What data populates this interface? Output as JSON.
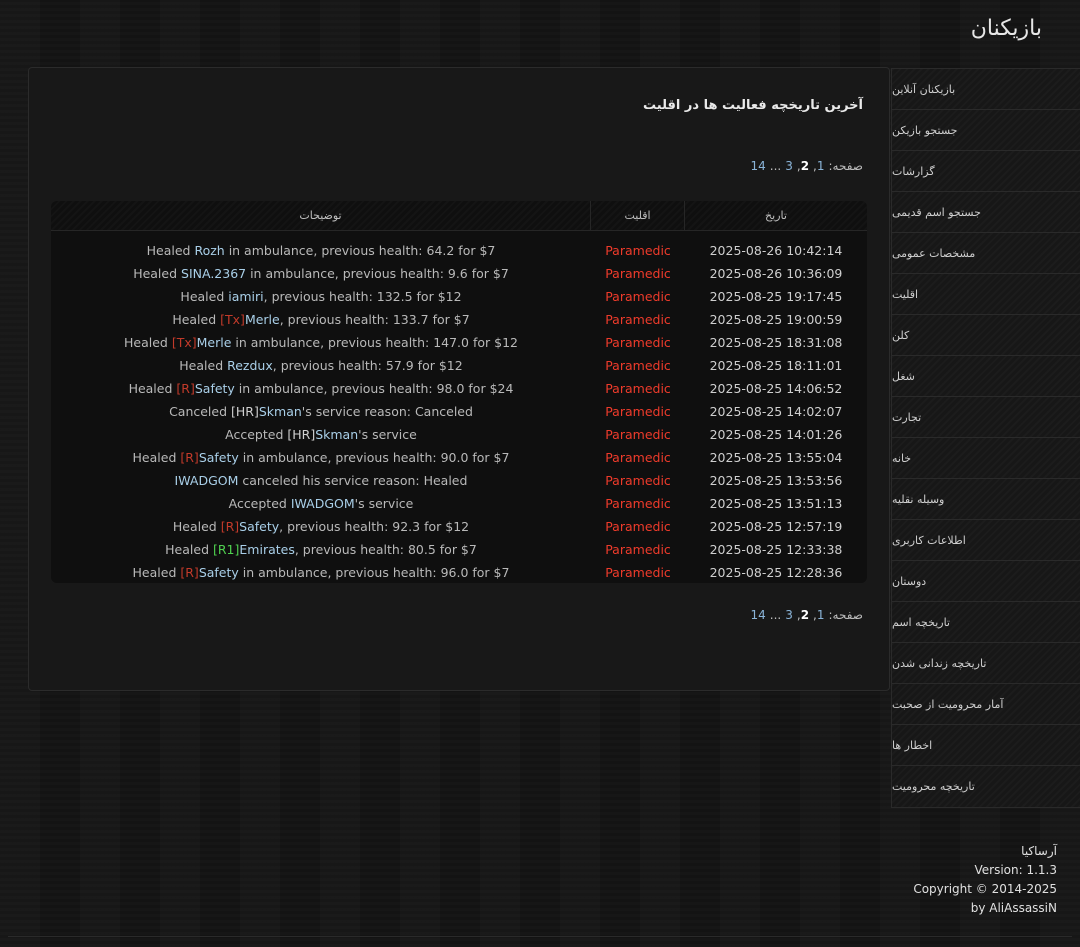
{
  "page_title": "بازیکنان",
  "main": {
    "heading": "آخرین تاریخچه فعالیت ها در اقلیت",
    "pager": {
      "label": "صفحه:",
      "p1": "1",
      "p2": "2",
      "p3": "3",
      "dots": "...",
      "last": "14"
    },
    "table": {
      "headers": {
        "date": "تاریخ",
        "faction": "اقلیت",
        "desc": "توضیحات"
      },
      "rows": [
        {
          "date": "2025-08-26 10:42:14",
          "faction": "Paramedic",
          "parts": [
            {
              "t": "Healed "
            },
            {
              "t": "Rozh",
              "c": "pn"
            },
            {
              "t": " in ambulance, previous health: 64.2 for $7"
            }
          ]
        },
        {
          "date": "2025-08-26 10:36:09",
          "faction": "Paramedic",
          "parts": [
            {
              "t": "Healed "
            },
            {
              "t": "SINA.2367",
              "c": "pn"
            },
            {
              "t": " in ambulance, previous health: 9.6 for $7"
            }
          ]
        },
        {
          "date": "2025-08-25 19:17:45",
          "faction": "Paramedic",
          "parts": [
            {
              "t": "Healed "
            },
            {
              "t": "iamiri",
              "c": "pn"
            },
            {
              "t": ", previous health: 132.5 for $12"
            }
          ]
        },
        {
          "date": "2025-08-25 19:00:59",
          "faction": "Paramedic",
          "parts": [
            {
              "t": "Healed "
            },
            {
              "t": "[Tx]",
              "c": "tg-red"
            },
            {
              "t": "Merle",
              "c": "pn"
            },
            {
              "t": ", previous health: 133.7 for $7"
            }
          ]
        },
        {
          "date": "2025-08-25 18:31:08",
          "faction": "Paramedic",
          "parts": [
            {
              "t": "Healed "
            },
            {
              "t": "[Tx]",
              "c": "tg-red"
            },
            {
              "t": "Merle",
              "c": "pn"
            },
            {
              "t": " in ambulance, previous health: 147.0 for $12"
            }
          ]
        },
        {
          "date": "2025-08-25 18:11:01",
          "faction": "Paramedic",
          "parts": [
            {
              "t": "Healed "
            },
            {
              "t": "Rezdux",
              "c": "pn"
            },
            {
              "t": ", previous health: 57.9 for $12"
            }
          ]
        },
        {
          "date": "2025-08-25 14:06:52",
          "faction": "Paramedic",
          "parts": [
            {
              "t": "Healed "
            },
            {
              "t": "[R]",
              "c": "tg-red"
            },
            {
              "t": "Safety",
              "c": "pn"
            },
            {
              "t": " in ambulance, previous health: 98.0 for $24"
            }
          ]
        },
        {
          "date": "2025-08-25 14:02:07",
          "faction": "Paramedic",
          "parts": [
            {
              "t": "Canceled "
            },
            {
              "t": "[HR]",
              "c": "tg-grey"
            },
            {
              "t": "Skman",
              "c": "pn"
            },
            {
              "t": "'s service reason: Canceled"
            }
          ]
        },
        {
          "date": "2025-08-25 14:01:26",
          "faction": "Paramedic",
          "parts": [
            {
              "t": "Accepted "
            },
            {
              "t": "[HR]",
              "c": "tg-grey"
            },
            {
              "t": "Skman",
              "c": "pn"
            },
            {
              "t": "'s service"
            }
          ]
        },
        {
          "date": "2025-08-25 13:55:04",
          "faction": "Paramedic",
          "parts": [
            {
              "t": "Healed "
            },
            {
              "t": "[R]",
              "c": "tg-red"
            },
            {
              "t": "Safety",
              "c": "pn"
            },
            {
              "t": " in ambulance, previous health: 90.0 for $7"
            }
          ]
        },
        {
          "date": "2025-08-25 13:53:56",
          "faction": "Paramedic",
          "parts": [
            {
              "t": "IWADGOM",
              "c": "pn"
            },
            {
              "t": " canceled his service reason: Healed"
            }
          ]
        },
        {
          "date": "2025-08-25 13:51:13",
          "faction": "Paramedic",
          "parts": [
            {
              "t": "Accepted "
            },
            {
              "t": "IWADGOM",
              "c": "pn"
            },
            {
              "t": "'s service"
            }
          ]
        },
        {
          "date": "2025-08-25 12:57:19",
          "faction": "Paramedic",
          "parts": [
            {
              "t": "Healed "
            },
            {
              "t": "[R]",
              "c": "tg-red"
            },
            {
              "t": "Safety",
              "c": "pn"
            },
            {
              "t": ", previous health: 92.3 for $12"
            }
          ]
        },
        {
          "date": "2025-08-25 12:33:38",
          "faction": "Paramedic",
          "parts": [
            {
              "t": "Healed "
            },
            {
              "t": "[R1]",
              "c": "tg-green"
            },
            {
              "t": "Emirates",
              "c": "pn"
            },
            {
              "t": ", previous health: 80.5 for $7"
            }
          ]
        },
        {
          "date": "2025-08-25 12:28:36",
          "faction": "Paramedic",
          "parts": [
            {
              "t": "Healed "
            },
            {
              "t": "[R]",
              "c": "tg-red"
            },
            {
              "t": "Safety",
              "c": "pn"
            },
            {
              "t": " in ambulance, previous health: 96.0 for $7"
            }
          ]
        }
      ]
    }
  },
  "sidebar": {
    "items": [
      "بازیکنان آنلاین",
      "جستجو بازیکن",
      "گزارشات",
      "جستجو اسم قدیمی",
      "مشخصات عمومی",
      "اقلیت",
      "کلن",
      "شغل",
      "تجارت",
      "خانه",
      "وسیله نقلیه",
      "اطلاعات کاربری",
      "دوستان",
      "تاریخچه اسم",
      "تاریخچه زندانی شدن",
      "آمار محرومیت از صحبت",
      "اخطار ها",
      "تاریخچه محرومیت"
    ]
  },
  "footer": {
    "site": "آرساکیا",
    "version": "Version: 1.1.3",
    "copyright": "Copyright © 2014-2025",
    "author": "by AliAssassiN"
  },
  "colors": {
    "faction": "#ee3b2b",
    "player_name": "#a9cfe8",
    "tag_red": "#c23a2a",
    "tag_green": "#4fd14f",
    "pager_link": "#8ab4d8"
  }
}
